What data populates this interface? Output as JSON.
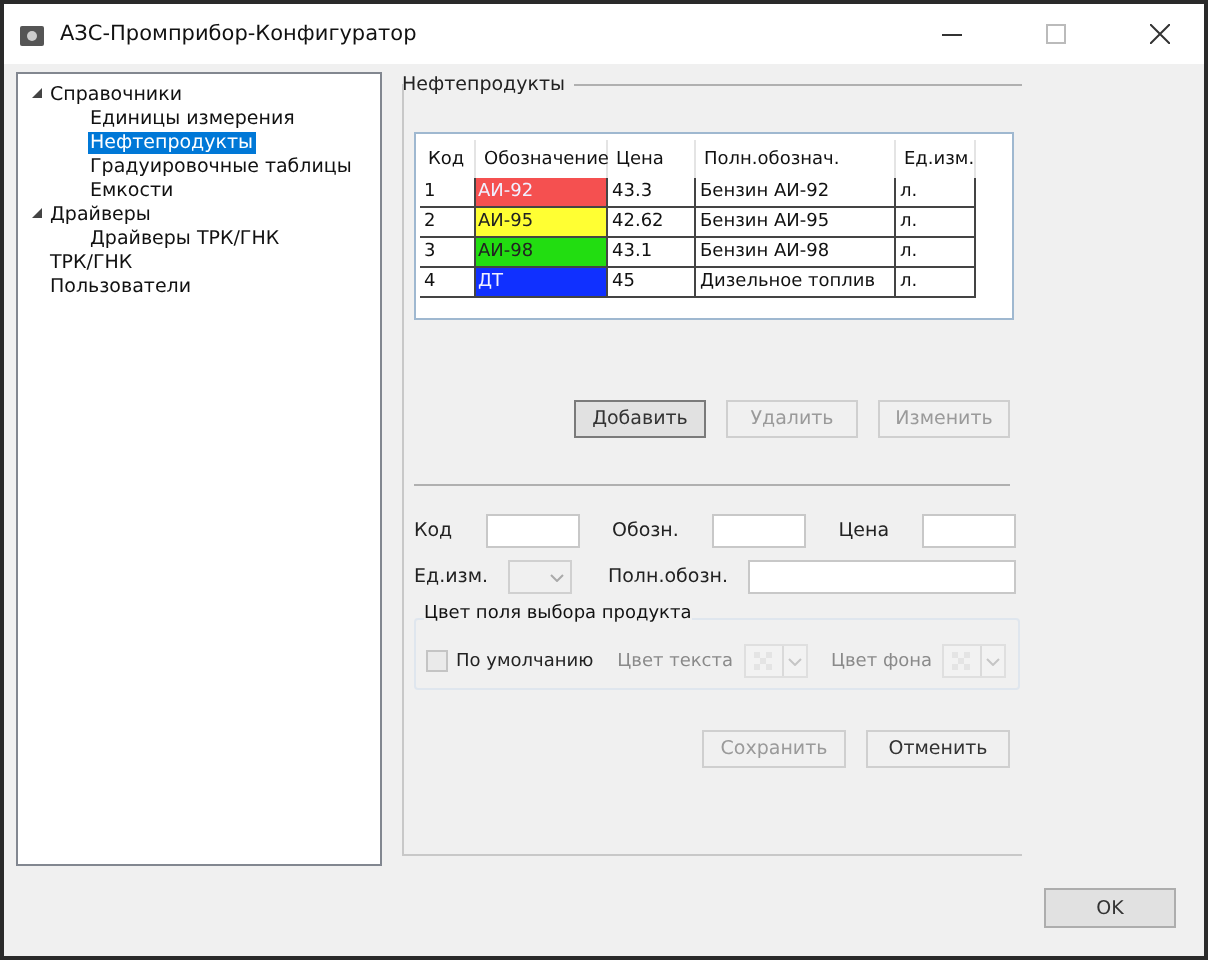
{
  "window": {
    "title": "АЗС-Промприбор-Конфигуратор"
  },
  "tree": [
    {
      "label": "Справочники",
      "expanded": true,
      "selected": false,
      "children": [
        {
          "label": "Единицы измерения",
          "selected": false
        },
        {
          "label": "Нефтепродукты",
          "selected": true
        },
        {
          "label": "Градуировочные таблицы",
          "selected": false
        },
        {
          "label": "Емкости",
          "selected": false
        }
      ]
    },
    {
      "label": "Драйверы",
      "expanded": true,
      "selected": false,
      "children": [
        {
          "label": "Драйверы ТРК/ГНК",
          "selected": false
        }
      ]
    },
    {
      "label": "ТРК/ГНК",
      "selected": false
    },
    {
      "label": "Пользователи",
      "selected": false
    }
  ],
  "group": {
    "title": "Нефтепродукты"
  },
  "table": {
    "columns": [
      "Код",
      "Обозначение",
      "Цена",
      "Полн.обознач.",
      "Ед.изм."
    ],
    "rows": [
      {
        "code": "1",
        "name": "АИ-92",
        "color": "#f55050",
        "price": "43.3",
        "full": "Бензин АИ-92",
        "unit": "л."
      },
      {
        "code": "2",
        "name": "АИ-95",
        "color": "#ffff33",
        "price": "42.62",
        "full": "Бензин АИ-95",
        "unit": "л."
      },
      {
        "code": "3",
        "name": "АИ-98",
        "color": "#22dd11",
        "price": "43.1",
        "full": "Бензин АИ-98",
        "unit": "л."
      },
      {
        "code": "4",
        "name": "ДТ",
        "color": "#1030ff",
        "price": "45",
        "full": "Дизельное топлив",
        "unit": "л."
      }
    ]
  },
  "actions": [
    {
      "label": "Добавить",
      "disabled": false,
      "default": true
    },
    {
      "label": "Удалить",
      "disabled": true,
      "default": false
    },
    {
      "label": "Изменить",
      "disabled": true,
      "default": false
    }
  ],
  "form": {
    "code": {
      "label": "Код"
    },
    "short": {
      "label": "Обозн."
    },
    "price": {
      "label": "Цена"
    },
    "unit": {
      "label": "Ед.изм.",
      "disabled": true
    },
    "full": {
      "label": "Полн.обозн."
    }
  },
  "color_group": {
    "title": "Цвет поля выбора продукта",
    "default_checkbox": {
      "label": "По умолчанию",
      "checked": false,
      "disabled": true
    },
    "pickers": [
      {
        "label": "Цвет текста",
        "disabled": true
      },
      {
        "label": "Цвет фона",
        "disabled": true
      }
    ]
  },
  "save_buttons": [
    {
      "label": "Сохранить",
      "disabled": true
    },
    {
      "label": "Отменить",
      "disabled": false
    }
  ],
  "ok_button": {
    "label": "OK"
  }
}
